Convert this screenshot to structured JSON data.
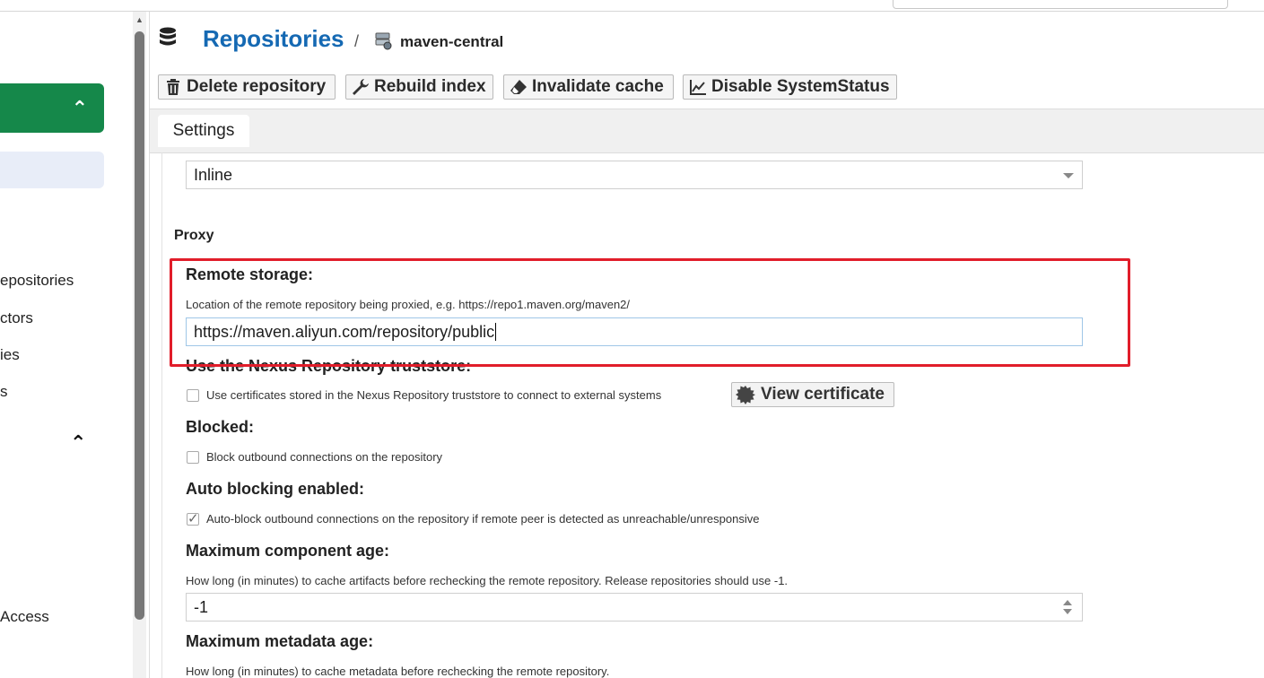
{
  "header": {
    "title": "Repositories",
    "breadcrumb_separator": "/",
    "repository_name": "maven-central"
  },
  "toolbar": {
    "delete_label": "Delete repository",
    "rebuild_label": "Rebuild index",
    "invalidate_label": "Invalidate cache",
    "disable_label": "Disable SystemStatus"
  },
  "tabs": {
    "settings": "Settings"
  },
  "sidebar": {
    "items": [
      "epositories",
      "ctors",
      "ies",
      "s",
      "Access"
    ]
  },
  "form": {
    "content_disposition_value": "Inline",
    "proxy_section": "Proxy",
    "remote_storage": {
      "label": "Remote storage:",
      "help": "Location of the remote repository being proxied, e.g. https://repo1.maven.org/maven2/",
      "value": "https://maven.aliyun.com/repository/public"
    },
    "truststore": {
      "label": "Use the Nexus Repository truststore:",
      "checkbox_text": "Use certificates stored in the Nexus Repository truststore to connect to external systems",
      "checked": false,
      "view_certificate_label": "View certificate"
    },
    "blocked": {
      "label": "Blocked:",
      "checkbox_text": "Block outbound connections on the repository",
      "checked": false
    },
    "auto_blocking": {
      "label": "Auto blocking enabled:",
      "checkbox_text": "Auto-block outbound connections on the repository if remote peer is detected as unreachable/unresponsive",
      "checked": true
    },
    "max_component_age": {
      "label": "Maximum component age:",
      "help": "How long (in minutes) to cache artifacts before rechecking the remote repository. Release repositories should use -1.",
      "value": "-1"
    },
    "max_metadata_age": {
      "label": "Maximum metadata age:",
      "help": "How long (in minutes) to cache metadata before rechecking the remote repository."
    }
  },
  "colors": {
    "title_blue": "#1569b3",
    "sidebar_active_green": "#15884a",
    "highlight_red": "#e11d2a"
  }
}
